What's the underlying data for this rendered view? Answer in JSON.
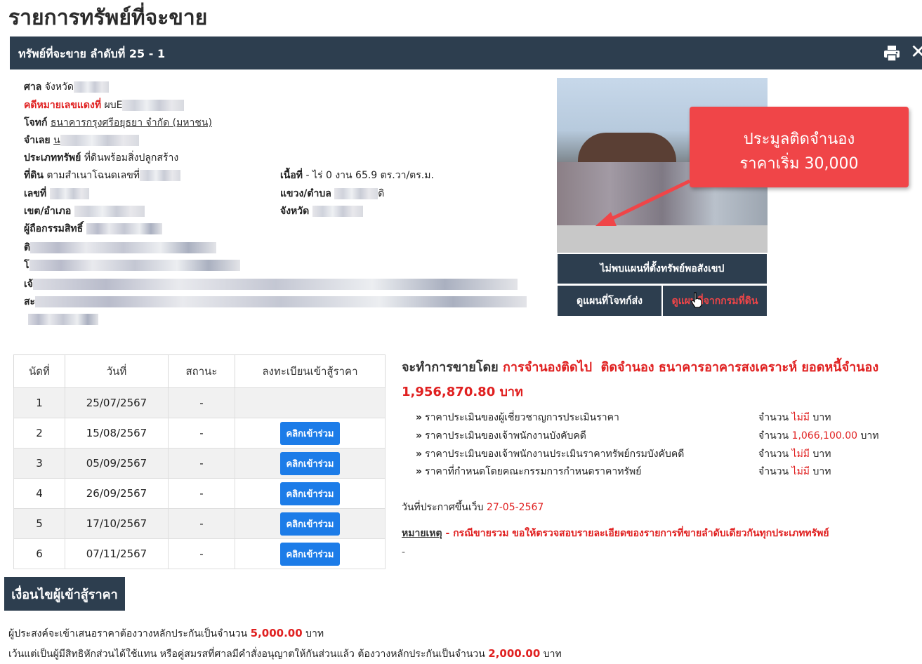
{
  "page_title": "รายการทรัพย์ที่จะขาย",
  "header": {
    "title": "ทรัพย์ที่จะขาย ลำดับที่ 25 - 1",
    "close_glyph": "✕"
  },
  "case_info": {
    "court_label": "ศาล",
    "court_value": "จังหวัด",
    "redcase_label": "คดีหมายเลขแดงที่",
    "redcase_value": "ผบE",
    "plaintiff_label": "โจทก์",
    "plaintiff_value": "ธนาคารกรุงศรีอยุธยา จำกัด (มหาชน)",
    "defendant_label": "จำเลย",
    "defendant_value": "น",
    "type_label": "ประเภททรัพย์",
    "type_value": "ที่ดินพร้อมสิ่งปลูกสร้าง",
    "land_label": "ที่ดิน",
    "land_value": "ตามสำเนาโฉนดเลขที่",
    "area_label": "เนื้อที่",
    "area_value": "- ไร่ 0 งาน 65.9 ตร.วา/ตร.ม.",
    "number_label": "เลขที่",
    "subdistrict_label": "แขวง/ตำบล",
    "subdistrict_value": "ดิ",
    "district_label": "เขต/อำเภอ",
    "province_label": "จังหวัด",
    "owner_label": "ผู้ถือกรรมสิทธิ์",
    "row_a_label": "ติ",
    "row_b_label": "โ",
    "row_c_label": "เจ้",
    "row_d_label": "สะ"
  },
  "callout": {
    "line1": "ประมูลติดจำนอง",
    "line2": "ราคาเริ่ม 30,000"
  },
  "map": {
    "not_found": "ไม่พบแผนที่ตั้งทรัพย์พอสังเขป",
    "plaintiff_map": "ดูแผนที่โจทก์ส่ง",
    "land_dept_map": "ดูแผนที่จากกรมที่ดิน"
  },
  "schedule": {
    "headers": [
      "นัดที่",
      "วันที่",
      "สถานะ",
      "ลงทะเบียนเข้าสู้ราคา"
    ],
    "rows": [
      {
        "no": "1",
        "date": "25/07/2567",
        "status": "-",
        "button": ""
      },
      {
        "no": "2",
        "date": "15/08/2567",
        "status": "-",
        "button": "คลิกเข้าร่วม"
      },
      {
        "no": "3",
        "date": "05/09/2567",
        "status": "-",
        "button": "คลิกเข้าร่วม"
      },
      {
        "no": "4",
        "date": "26/09/2567",
        "status": "-",
        "button": "คลิกเข้าร่วม"
      },
      {
        "no": "5",
        "date": "17/10/2567",
        "status": "-",
        "button": "คลิกเข้าร่วม"
      },
      {
        "no": "6",
        "date": "07/11/2567",
        "status": "-",
        "button": "คลิกเข้าร่วม"
      }
    ]
  },
  "sale": {
    "prefix": "จะทำการขายโดย",
    "method": "การจำนองติดไป",
    "mortgage": "ติดจำนอง ธนาคารอาคารสงเคราะห์ ยอดหนี้จำนอง",
    "amount": "1,956,870.80 บาท",
    "bullet": "»",
    "prices": [
      {
        "label": "ราคาประเมินของผู้เชี่ยวชาญการประเมินราคา",
        "prefix": "จำนวน",
        "value": "ไม่มี",
        "unit": "บาท"
      },
      {
        "label": "ราคาประเมินของเจ้าพนักงานบังคับคดี",
        "prefix": "จำนวน",
        "value": "1,066,100.00",
        "unit": "บาท"
      },
      {
        "label": "ราคาประเมินของเจ้าพนักงานประเมินราคาทรัพย์กรมบังคับคดี",
        "prefix": "จำนวน",
        "value": "ไม่มี",
        "unit": "บาท"
      },
      {
        "label": "ราคาที่กำหนดโดยคณะกรรมการกำหนดราคาทรัพย์",
        "prefix": "จำนวน",
        "value": "ไม่มี",
        "unit": "บาท"
      }
    ],
    "announce_label": "วันที่ประกาศขึ้นเว็บ",
    "announce_date": "27-05-2567",
    "note_label": "หมายเหตุ",
    "note_text": "- กรณีขายรวม ขอให้ตรวจสอบรายละเอียดของรายการที่ขายลำดับเดียวกันทุกประเภททรัพย์",
    "note_dash": "-"
  },
  "conditions": {
    "title": "เงื่อนไขผู้เข้าสู้ราคา",
    "line1_text": "ผู้ประสงค์จะเข้าเสนอราคาต้องวางหลักประกันเป็นจำนวน",
    "line1_amount": "5,000.00",
    "line1_unit": "บาท",
    "line2_text": "เว้นแต่เป็นผู้มีสิทธิหักส่วนได้ใช้แทน หรือคู่สมรสที่ศาลมีคำสั่งอนุญาตให้กันส่วนแล้ว ต้องวางหลักประกันเป็นจำนวน",
    "line2_amount": "2,000.00",
    "line2_unit": "บาท"
  },
  "colors": {
    "navy": "#2d3e4f",
    "red": "#e02020",
    "button_blue": "#1c7ce8",
    "callout": "#f04548"
  }
}
